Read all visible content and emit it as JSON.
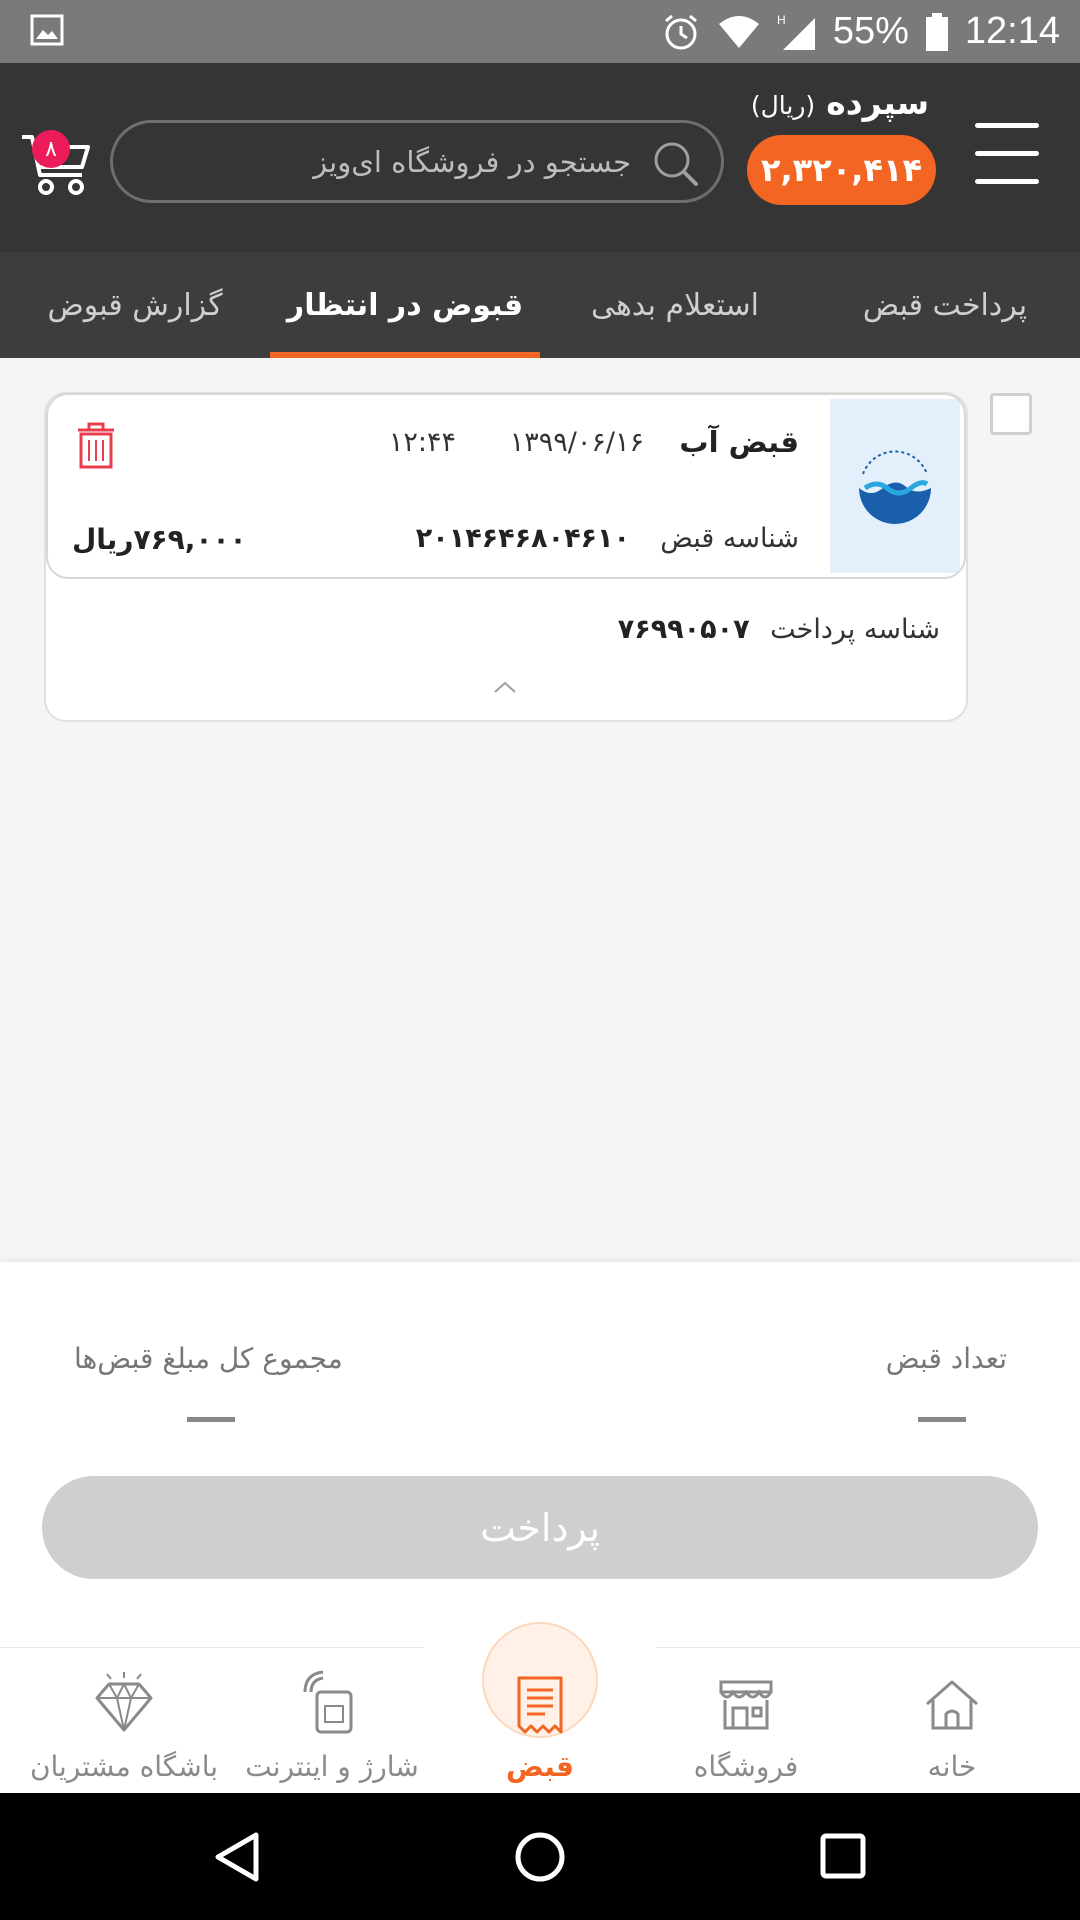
{
  "status_bar": {
    "battery": "55%",
    "time": "12:14",
    "network": "H"
  },
  "header": {
    "credit_title": "سپرده",
    "credit_unit": "(ریال)",
    "credit_amount": "۲,۳۲۰,۴۱۴",
    "search_placeholder": "جستجو در فروشگاه ای‌ویز",
    "cart_count": "۸"
  },
  "tabs": [
    {
      "label": "پرداخت قبض"
    },
    {
      "label": "استعلام بدهی"
    },
    {
      "label": "قبوض در انتظار"
    },
    {
      "label": "گزارش قبوض"
    }
  ],
  "bill": {
    "title": "قبض آب",
    "date": "۱۳۹۹/۰۶/۱۶",
    "time": "۱۲:۴۴",
    "id_label": "شناسه قبض",
    "id_value": "۲۰۱۴۶۴۶۸۰۴۶۱۰",
    "amount": "۷۶۹,۰۰۰ریال",
    "pay_id_label": "شناسه پرداخت",
    "pay_id_value": "۷۶۹۹۰۵۰۷"
  },
  "summary": {
    "count_label": "تعداد قبض",
    "total_label": "مجموع کل مبلغ قبض‌ها",
    "pay_button": "پرداخت"
  },
  "bottom_nav": [
    {
      "label": "خانه"
    },
    {
      "label": "فروشگاه"
    },
    {
      "label": "قبض"
    },
    {
      "label": "شارژ و اینترنت"
    },
    {
      "label": "باشگاه مشتریان"
    }
  ],
  "colors": {
    "accent": "#f26522",
    "header_bg": "#353535",
    "tabs_bg": "#3d3d3d",
    "badge": "#ec1c5a"
  }
}
